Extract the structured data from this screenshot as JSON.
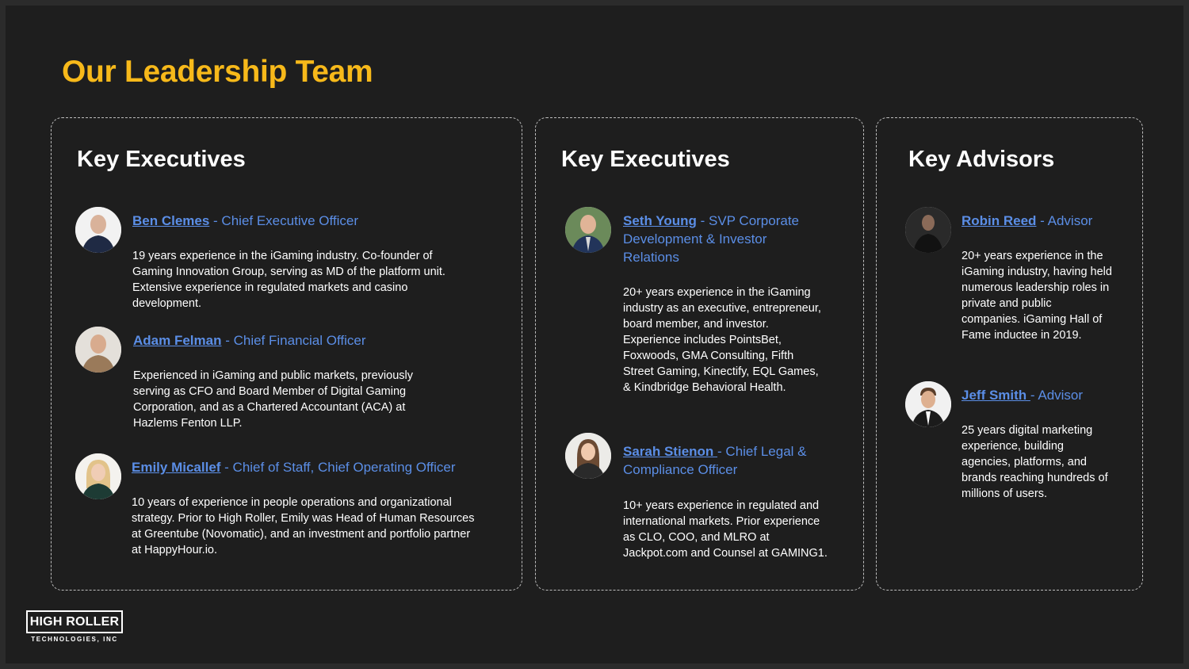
{
  "title": "Our Leadership Team",
  "panels": [
    {
      "title": "Key Executives",
      "people": [
        {
          "name": "Ben Clemes",
          "role": " - Chief Executive Officer",
          "bio": "19 years experience in the iGaming industry. Co-founder of Gaming Innovation Group, serving as MD of the platform unit. Extensive experience in regulated markets and casino development."
        },
        {
          "name": "Adam Felman",
          "role": " - Chief Financial Officer",
          "bio": "Experienced in iGaming and public markets, previously serving as CFO and Board Member of Digital Gaming Corporation, and as a Chartered Accountant (ACA) at Hazlems Fenton LLP."
        },
        {
          "name": "Emily Micallef",
          "role": " - Chief of Staff, Chief Operating Officer",
          "bio": "10 years of experience in people operations and organizational strategy. Prior to High Roller, Emily was Head of Human Resources at Greentube (Novomatic), and an investment and portfolio partner at HappyHour.io."
        }
      ]
    },
    {
      "title": "Key Executives",
      "people": [
        {
          "name": "Seth Young",
          "role": " - SVP Corporate Development & Investor Relations",
          "bio": "20+ years experience in the iGaming industry as an executive, entrepreneur, board member, and investor. Experience includes PointsBet, Foxwoods, GMA Consulting, Fifth Street Gaming, Kinectify, EQL Games, & Kindbridge Behavioral Health."
        },
        {
          "name": "Sarah Stienon ",
          "role": "- Chief Legal & Compliance Officer",
          "bio": "10+ years experience in regulated and international markets. Prior experience as CLO, COO, and MLRO at Jackpot.com and Counsel at GAMING1."
        }
      ]
    },
    {
      "title": "Key Advisors",
      "people": [
        {
          "name": "Robin Reed",
          "role": " - Advisor",
          "bio": "20+ years experience in the iGaming industry, having held numerous leadership roles in private and public companies. iGaming Hall of Fame inductee in 2019."
        },
        {
          "name": "Jeff Smith ",
          "role": "- Advisor",
          "bio": "25 years digital marketing experience, building agencies, platforms, and brands reaching hundreds of millions of users."
        }
      ]
    }
  ],
  "logo": {
    "main": "HIGH ROLLER",
    "sub": "TECHNOLOGIES, INC"
  },
  "colors": {
    "accent": "#f7b91a",
    "link": "#5b8ee6",
    "background": "#1e1e1e"
  }
}
